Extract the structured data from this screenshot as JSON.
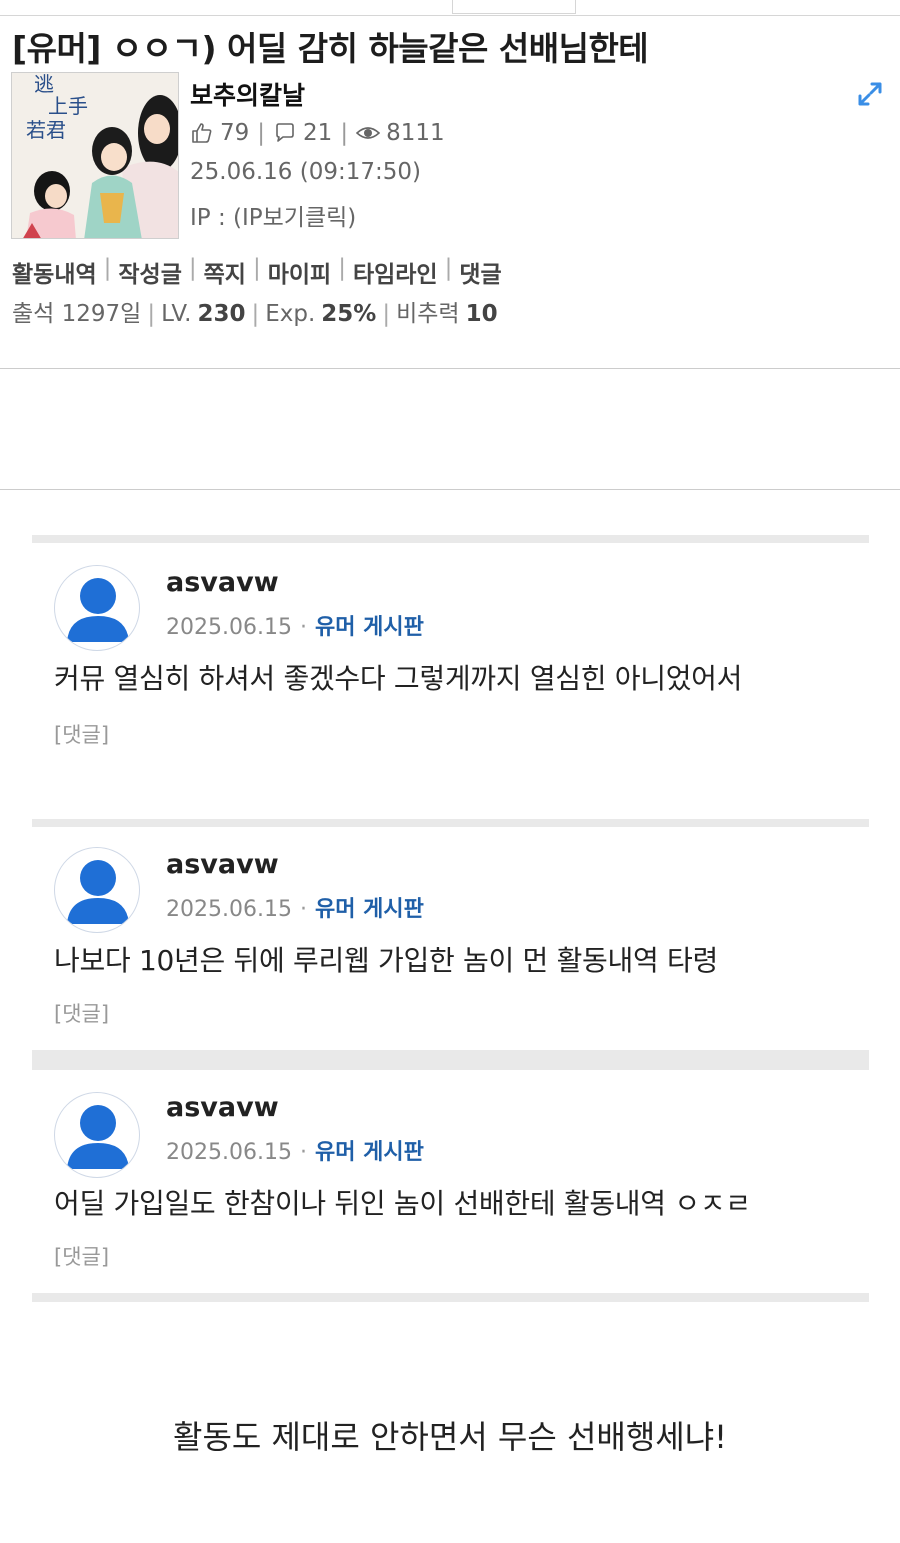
{
  "post": {
    "title": "[유머] ㅇㅇㄱ) 어딜 감히 하늘같은 선배님한테",
    "author": "보추의칼날",
    "likes": "79",
    "comments": "21",
    "views": "8111",
    "date": "25.06.16 (09:17:50)",
    "ip": "IP : (IP보기클릭)",
    "avatar_text": "逃げ上手の若君"
  },
  "menu": [
    "활동내역",
    "작성글",
    "쪽지",
    "마이피",
    "타임라인",
    "댓글"
  ],
  "level": {
    "attendance": "출석 1297일",
    "lv_label": "LV.",
    "lv_value": "230",
    "exp_label": "Exp.",
    "exp_value": "25%",
    "ratio_label": "비추력",
    "ratio_value": "10"
  },
  "comments": [
    {
      "name": "asvavw",
      "date": "2025.06.15",
      "board": "유머 게시판",
      "text": "커뮤 열심히 하셔서 좋겠수다 그렇게까지 열심힌 아니었어서",
      "reply": "[댓글]"
    },
    {
      "name": "asvavw",
      "date": "2025.06.15",
      "board": "유머 게시판",
      "text": "나보다 10년은 뒤에 루리웹 가입한 놈이 먼 활동내역 타령",
      "reply": "[댓글]"
    },
    {
      "name": "asvavw",
      "date": "2025.06.15",
      "board": "유머 게시판",
      "text": "어딜 가입일도 한참이나 뒤인 놈이 선배한테 활동내역 ㅇㅈㄹ",
      "reply": "[댓글]"
    }
  ],
  "closing": "활동도 제대로 안하면서 무슨 선배행세냐!",
  "colors": {
    "board_link": "#1f5fa8",
    "avatar_blue": "#1f6fd6",
    "expand_icon": "#3a8ee6"
  }
}
